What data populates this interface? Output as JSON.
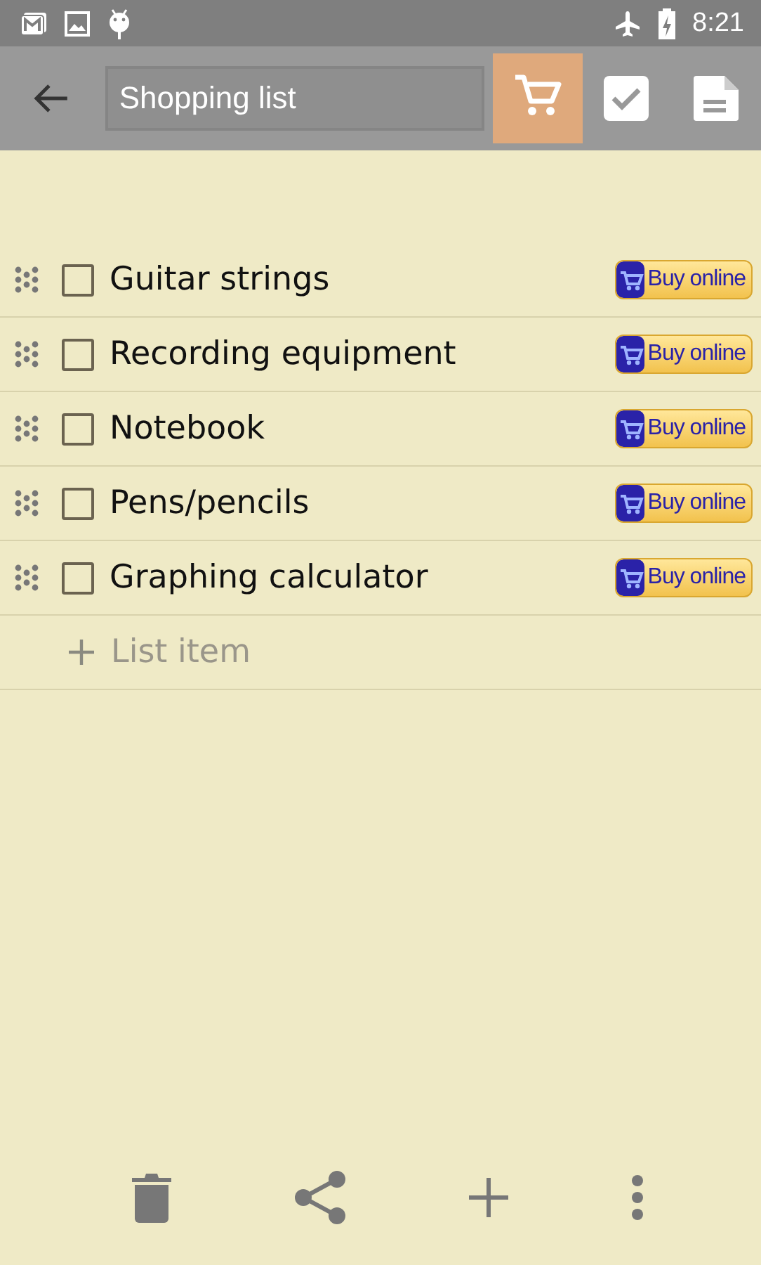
{
  "status_bar": {
    "time": "8:21"
  },
  "toolbar": {
    "title_field": {
      "value": "Shopping list"
    },
    "modes": [
      {
        "kind": "cart",
        "selected": true
      },
      {
        "kind": "checklist",
        "selected": false
      },
      {
        "kind": "note",
        "selected": false
      }
    ]
  },
  "items": [
    {
      "text": "Guitar strings",
      "checked": false,
      "button": "Buy online"
    },
    {
      "text": "Recording equipment",
      "checked": false,
      "button": "Buy online"
    },
    {
      "text": "Notebook",
      "checked": false,
      "button": "Buy online"
    },
    {
      "text": "Pens/pencils",
      "checked": false,
      "button": "Buy online"
    },
    {
      "text": "Graphing calculator",
      "checked": false,
      "button": "Buy online"
    }
  ],
  "add_item": {
    "placeholder": "List item"
  }
}
